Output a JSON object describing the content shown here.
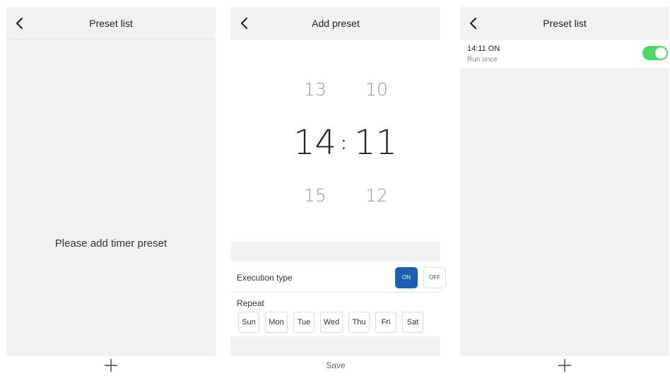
{
  "panels": {
    "empty_list": {
      "title": "Preset list",
      "empty_message": "Please add timer preset",
      "add_icon": "plus-icon",
      "back_icon": "chevron-left-icon"
    },
    "add_preset": {
      "title": "Add preset",
      "back_icon": "chevron-left-icon",
      "picker": {
        "hour_prev": "13",
        "hour_selected": "14",
        "hour_next": "15",
        "separator": ":",
        "minute_prev": "10",
        "minute_selected": "11",
        "minute_next": "12"
      },
      "execution_type_label": "Execution type",
      "on_label": "ON",
      "off_label": "OFF",
      "selected_execution": "ON",
      "repeat_label": "Repeat",
      "days": [
        "Sun",
        "Mon",
        "Tue",
        "Wed",
        "Thu",
        "Fri",
        "Sat"
      ],
      "save_label": "Save"
    },
    "filled_list": {
      "title": "Preset list",
      "back_icon": "chevron-left-icon",
      "add_icon": "plus-icon",
      "items": [
        {
          "time_state": "14:11  ON",
          "schedule": "Run once",
          "enabled": true
        }
      ]
    }
  },
  "colors": {
    "accent_blue": "#1b5fb2",
    "toggle_green": "#4cd964",
    "background_gray": "#f1f1f1"
  }
}
